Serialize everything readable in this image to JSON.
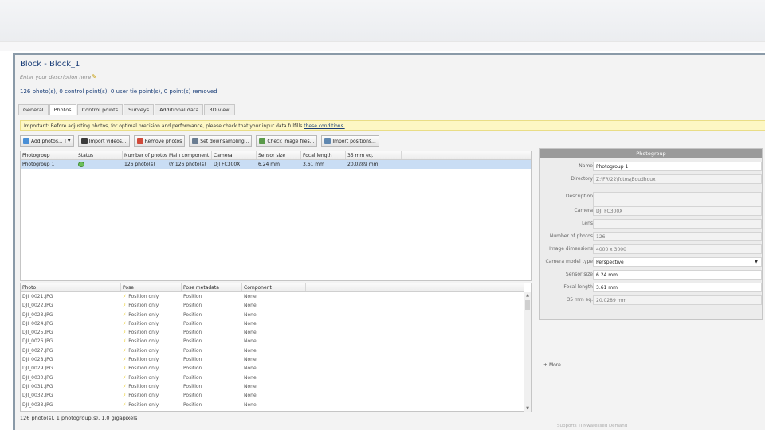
{
  "block": {
    "title": "Block - Block_1",
    "description_hint": "Enter your description here",
    "summary": "126 photo(s), 0 control point(s), 0 user tie point(s), 0 point(s) removed"
  },
  "tabs": [
    "General",
    "Photos",
    "Control points",
    "Surveys",
    "Additional data",
    "3D view"
  ],
  "warning": {
    "text": "Important: Before adjusting photos, for optimal precision and performance, please check that your input data fulfills",
    "link": "these conditions."
  },
  "toolbar": {
    "add_photos": "Add photos...",
    "import_videos": "Import videos...",
    "remove_photos": "Remove photos",
    "set_downsampling": "Set downsampling...",
    "check_image_files": "Check image files...",
    "import_positions": "Import positions..."
  },
  "photogroups_table": {
    "columns": [
      "Photogroup",
      "Status",
      "Number of photos",
      "Main component",
      "Camera",
      "Sensor size",
      "Focal length",
      "35 mm eq."
    ],
    "rows": [
      [
        "Photogroup 1",
        "",
        "126 photo(s)",
        "(Y 126 photo(s)",
        "DJI FC300X",
        "6.24 mm",
        "3.61 mm",
        "20.0289 mm"
      ]
    ]
  },
  "photos_table": {
    "columns": [
      "Photo",
      "Pose",
      "Pose metadata",
      "Component"
    ],
    "rows": [
      [
        "DJI_0021.JPG",
        "Position only",
        "Position",
        "None"
      ],
      [
        "DJI_0022.JPG",
        "Position only",
        "Position",
        "None"
      ],
      [
        "DJI_0023.JPG",
        "Position only",
        "Position",
        "None"
      ],
      [
        "DJI_0024.JPG",
        "Position only",
        "Position",
        "None"
      ],
      [
        "DJI_0025.JPG",
        "Position only",
        "Position",
        "None"
      ],
      [
        "DJI_0026.JPG",
        "Position only",
        "Position",
        "None"
      ],
      [
        "DJI_0027.JPG",
        "Position only",
        "Position",
        "None"
      ],
      [
        "DJI_0028.JPG",
        "Position only",
        "Position",
        "None"
      ],
      [
        "DJI_0029.JPG",
        "Position only",
        "Position",
        "None"
      ],
      [
        "DJI_0030.JPG",
        "Position only",
        "Position",
        "None"
      ],
      [
        "DJI_0031.JPG",
        "Position only",
        "Position",
        "None"
      ],
      [
        "DJI_0032.JPG",
        "Position only",
        "Position",
        "None"
      ],
      [
        "DJI_0033.JPG",
        "Position only",
        "Position",
        "None"
      ]
    ]
  },
  "bottom_info": "126 photo(s), 1 photogroup(s), 1.0 gigapixels",
  "properties": {
    "header": "Photogroup",
    "fields": [
      {
        "label": "Name",
        "value": "Photogroup 1",
        "editable": true
      },
      {
        "label": "Directory",
        "value": "Z:\\FR\\22\\fotos\\Boudhoux",
        "editable": false
      },
      {
        "label": "Description",
        "value": "",
        "editable": false
      },
      {
        "label": "Camera",
        "value": "DJI FC300X",
        "editable": false
      },
      {
        "label": "Lens",
        "value": "",
        "editable": false
      },
      {
        "label": "Number of photos",
        "value": "126",
        "editable": false
      },
      {
        "label": "Image dimensions",
        "value": "4000 x 3000",
        "editable": false
      },
      {
        "label": "Camera model type",
        "value": "Perspective",
        "editable": true,
        "dropdown": true
      },
      {
        "label": "Sensor size",
        "value": "6.24 mm",
        "editable": true
      },
      {
        "label": "Focal length",
        "value": "3.61 mm",
        "editable": true
      },
      {
        "label": "35 mm eq.",
        "value": "20.0289 mm",
        "editable": false
      }
    ],
    "more": "More..."
  },
  "footer_right": "Supports TI Nwaressed Demand",
  "colors": {
    "title": "#1a3e78",
    "selection": "#c9ddf4",
    "warning_bg": "#fdf7c4",
    "pose_icon": "#e6c200"
  }
}
